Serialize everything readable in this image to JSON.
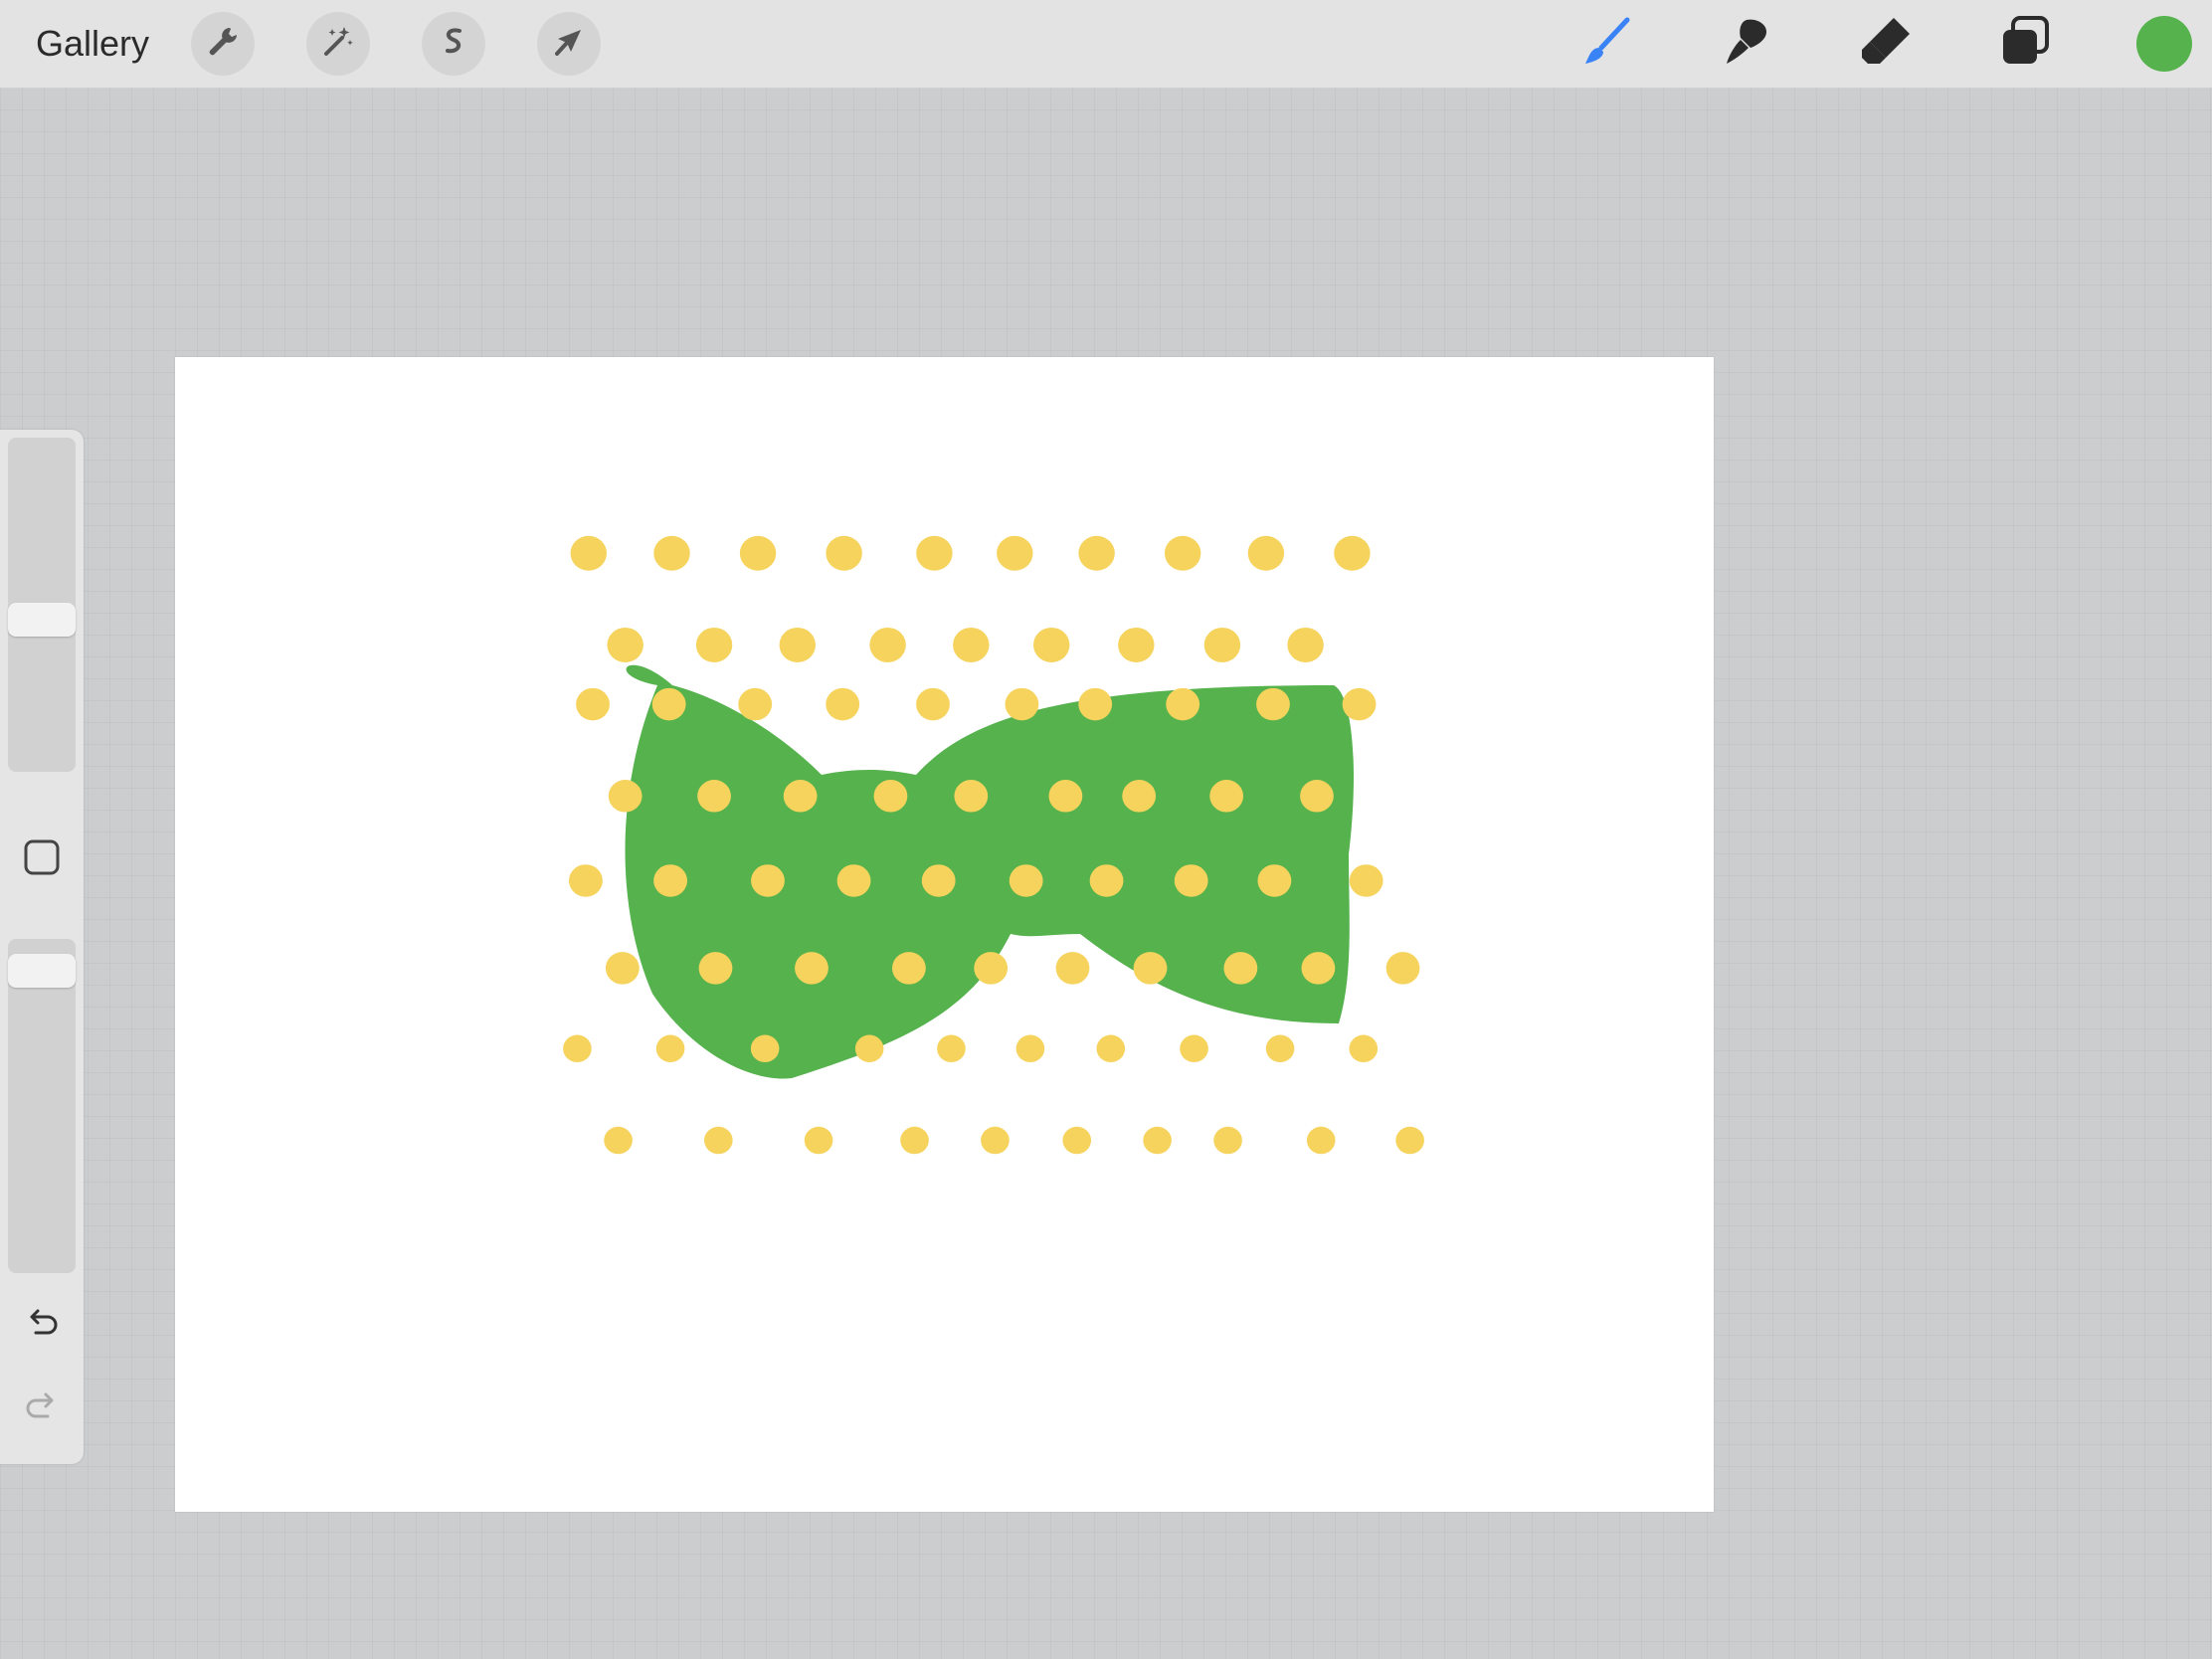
{
  "toolbar": {
    "gallery_label": "Gallery",
    "left_tools": [
      "wrench-icon",
      "magic-wand-icon",
      "selection-icon",
      "transform-arrow-icon"
    ],
    "right_tools": [
      "brush-icon",
      "smudge-icon",
      "eraser-icon",
      "layers-icon"
    ],
    "active_tool": "brush-icon",
    "active_tool_color": "#3a83f6",
    "current_color": "#55b24d"
  },
  "sidebar": {
    "brush_size_level": 0.55,
    "opacity_level": 0.05,
    "modify_button_icon": "square-icon",
    "undo_icon": "undo-icon",
    "redo_icon": "redo-icon"
  },
  "artwork": {
    "subject": "bow-tie",
    "bow_color": "#55b24d",
    "dot_color": "#f5d35c",
    "background_color": "#ffffff"
  }
}
